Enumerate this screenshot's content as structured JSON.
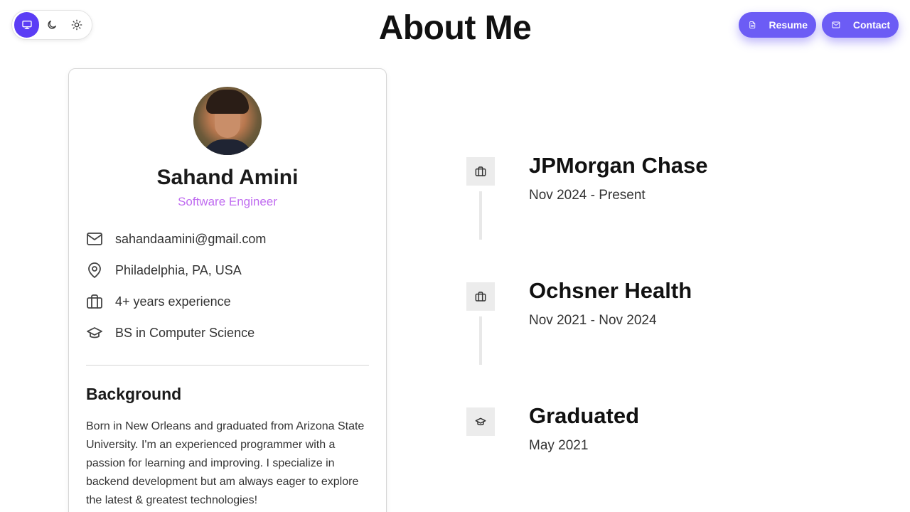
{
  "page": {
    "title": "About Me"
  },
  "theme_switcher": {
    "options": [
      {
        "icon": "monitor-icon",
        "active": true
      },
      {
        "icon": "moon-icon",
        "active": false
      },
      {
        "icon": "sun-icon",
        "active": false
      }
    ],
    "accent_color": "#5b3df5"
  },
  "header_buttons": {
    "resume_label": "Resume",
    "resume_icon": "document-icon",
    "contact_label": "Contact",
    "contact_icon": "mail-icon",
    "color": "#6c5cf5"
  },
  "profile": {
    "name": "Sahand Amini",
    "role": "Software Engineer",
    "role_color": "#c06cf0",
    "details": [
      {
        "icon": "mail-icon",
        "text": "sahandaamini@gmail.com"
      },
      {
        "icon": "map-pin-icon",
        "text": "Philadelphia, PA, USA"
      },
      {
        "icon": "briefcase-icon",
        "text": "4+ years experience"
      },
      {
        "icon": "graduation-cap-icon",
        "text": "BS in Computer Science"
      }
    ],
    "background_title": "Background",
    "background_text": "Born in New Orleans and graduated from Arizona State University. I'm an experienced programmer with a passion for learning and improving. I specialize in backend development but am always eager to explore the latest & greatest technologies!"
  },
  "timeline": [
    {
      "icon": "briefcase-icon",
      "title": "JPMorgan Chase",
      "date": "Nov 2024 - Present"
    },
    {
      "icon": "briefcase-icon",
      "title": "Ochsner Health",
      "date": "Nov 2021 - Nov 2024"
    },
    {
      "icon": "graduation-cap-icon",
      "title": "Graduated",
      "date": "May 2021"
    }
  ]
}
